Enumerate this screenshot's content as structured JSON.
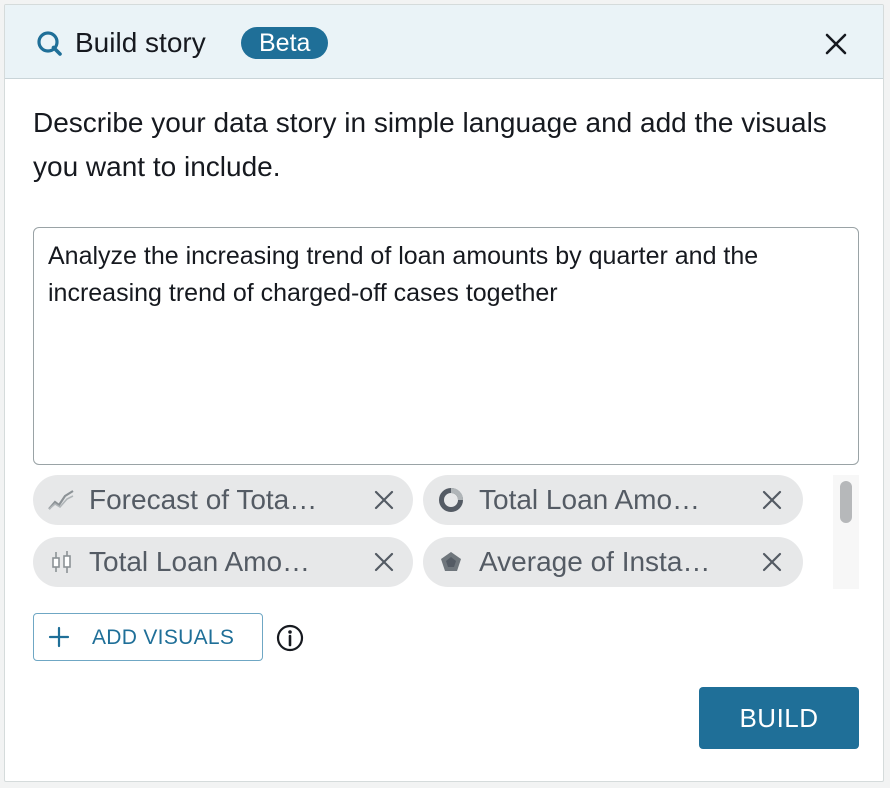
{
  "header": {
    "title": "Build story",
    "badge": "Beta",
    "logo_icon": "quicksight-q-icon",
    "close_icon": "close-icon"
  },
  "description": "Describe your data story in simple language and add the visuals you want to include.",
  "prompt": {
    "value": "Analyze the increasing trend of loan amounts by quarter and the increasing trend of charged-off cases together"
  },
  "visuals": [
    {
      "label": "Forecast of Tota…",
      "icon": "line-chart-icon"
    },
    {
      "label": "Total Loan Amo…",
      "icon": "donut-chart-icon"
    },
    {
      "label": "Total Loan Amo…",
      "icon": "box-plot-icon"
    },
    {
      "label": "Average of Insta…",
      "icon": "radar-chart-icon"
    }
  ],
  "actions": {
    "add_visuals_label": "ADD VISUALS",
    "build_label": "BUILD"
  },
  "colors": {
    "accent": "#1f6f98",
    "header_bg": "#eaf3f7",
    "chip_bg": "#e7e8e9"
  }
}
